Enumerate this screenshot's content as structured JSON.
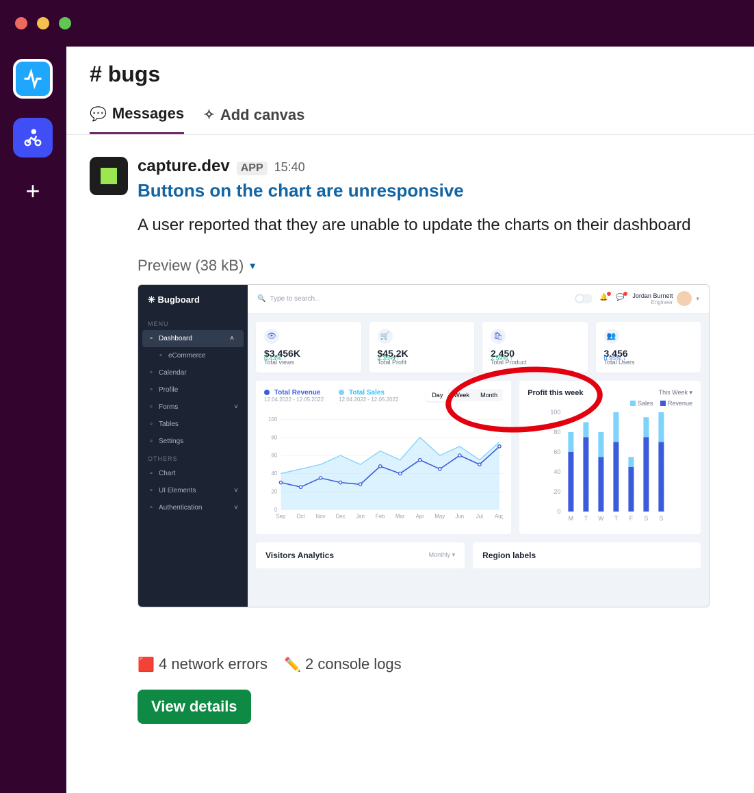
{
  "window": {
    "channel_title": "# bugs"
  },
  "rail": {
    "items": [
      "pulse",
      "cyclist"
    ],
    "plus_label": "+"
  },
  "tabs": {
    "messages": "Messages",
    "add_canvas": "Add canvas"
  },
  "message": {
    "sender": "capture.dev",
    "badge": "APP",
    "time": "15:40",
    "title_link": "Buttons on the chart are unresponsive",
    "body": "A user reported that they are unable to update the charts on their dashboard",
    "preview_label": "Preview (38 kB)"
  },
  "dashboard": {
    "brand": "Bugboard",
    "search_placeholder": "Type to search...",
    "user": {
      "name": "Jordan Burnett",
      "role": "Engineer"
    },
    "menu_section": "MENU",
    "others_section": "OTHERS",
    "menu": [
      {
        "label": "Dashboard",
        "active": true,
        "expand": true
      },
      {
        "label": "eCommerce",
        "sub": true
      },
      {
        "label": "Calendar"
      },
      {
        "label": "Profile"
      },
      {
        "label": "Forms",
        "expand": true
      },
      {
        "label": "Tables"
      },
      {
        "label": "Settings"
      }
    ],
    "others": [
      {
        "label": "Chart"
      },
      {
        "label": "UI Elements",
        "expand": true
      },
      {
        "label": "Authentication",
        "expand": true
      }
    ],
    "cards": [
      {
        "value": "$3.456K",
        "label": "Total views",
        "pct": "0.43% ↑",
        "icon": "👁"
      },
      {
        "value": "$45,2K",
        "label": "Total Profit",
        "pct": "4.35% ↑",
        "icon": "🛒"
      },
      {
        "value": "2.450",
        "label": "Total Product",
        "pct": "2.59% ↑",
        "icon": "🛍"
      },
      {
        "value": "3.456",
        "label": "Total Users",
        "pct": "0.95% ↓",
        "icon": "👥",
        "down": true
      }
    ],
    "chart_range": {
      "options": [
        "Day",
        "Week",
        "Month"
      ],
      "active": "Day"
    },
    "chart1": {
      "series_a": {
        "name": "Total Revenue",
        "sub": "12.04.2022 - 12.05.2022",
        "color": "#3b5bdb"
      },
      "series_b": {
        "name": "Total Sales",
        "sub": "12.04.2022 - 12.05.2022",
        "color": "#7dd3fc"
      }
    },
    "profit": {
      "title": "Profit this week",
      "selector": "This Week ▾",
      "legend_a": "Sales",
      "legend_b": "Revenue"
    },
    "visitors": {
      "title": "Visitors Analytics",
      "selector": "Monthly ▾"
    },
    "region": {
      "title": "Region labels"
    }
  },
  "chart_data": [
    {
      "type": "line",
      "title": "",
      "xlabel": "",
      "ylabel": "",
      "ylim": [
        0,
        100
      ],
      "categories": [
        "Sep",
        "Oct",
        "Nov",
        "Dec",
        "Jan",
        "Feb",
        "Mar",
        "Apr",
        "May",
        "Jun",
        "Jul",
        "Aug"
      ],
      "series": [
        {
          "name": "Total Revenue",
          "color": "#3b5bdb",
          "values": [
            30,
            25,
            35,
            30,
            28,
            48,
            40,
            55,
            45,
            60,
            50,
            70
          ]
        },
        {
          "name": "Total Sales",
          "color": "#7dd3fc",
          "values": [
            40,
            45,
            50,
            60,
            50,
            65,
            55,
            80,
            60,
            70,
            55,
            75
          ]
        }
      ]
    },
    {
      "type": "bar",
      "title": "Profit this week",
      "xlabel": "",
      "ylabel": "",
      "ylim": [
        0,
        100
      ],
      "categories": [
        "M",
        "T",
        "W",
        "T",
        "F",
        "S",
        "S"
      ],
      "series": [
        {
          "name": "Sales",
          "color": "#7dd3fc",
          "values": [
            20,
            15,
            25,
            30,
            10,
            20,
            30
          ]
        },
        {
          "name": "Revenue",
          "color": "#3b5bdb",
          "values": [
            60,
            75,
            55,
            70,
            45,
            75,
            70
          ]
        }
      ]
    }
  ],
  "attachments": {
    "network": "4 network errors",
    "console": "2 console logs"
  },
  "actions": {
    "view_details": "View details"
  }
}
